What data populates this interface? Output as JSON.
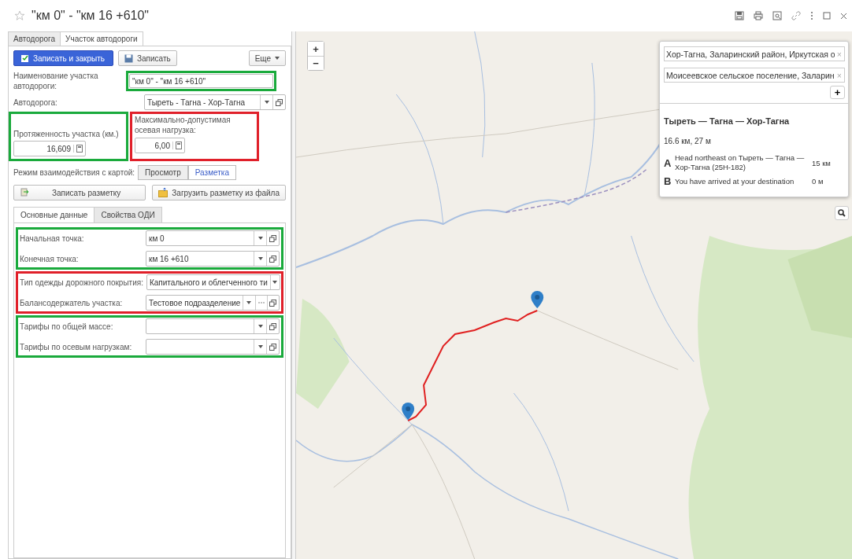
{
  "window": {
    "title": "\"км 0\" - \"км 16 +610\"",
    "favorite": false
  },
  "tabs": [
    {
      "label": "Автодорога",
      "selected": false
    },
    {
      "label": "Участок автодороги",
      "selected": true
    }
  ],
  "toolbar": {
    "save_close": "Записать и закрыть",
    "save": "Записать",
    "more": "Еще"
  },
  "name_field": {
    "label": "Наименование участка автодороги:",
    "value": "\"км 0\" - \"км 16 +610\"",
    "color": "#1aaa3c"
  },
  "road_field": {
    "label": "Автодорога:",
    "value": "Тыреть - Тагна - Хор-Тагна"
  },
  "length_field": {
    "label": "Протяженность участка (км.)",
    "value": "16,609",
    "color": "#1aaa3c"
  },
  "load_field": {
    "label": "Максимально-допустимая осевая нагрузка:",
    "value": "6,00",
    "color": "#e0202a"
  },
  "map_mode": {
    "label": "Режим взаимодействия с картой:",
    "options": [
      {
        "label": "Просмотр",
        "selected": false
      },
      {
        "label": "Разметка",
        "selected": true
      }
    ]
  },
  "markup_buttons": [
    "Записать разметку",
    "Загрузить разметку из файла"
  ],
  "inner_tabs": [
    {
      "label": "Основные данные",
      "selected": true
    },
    {
      "label": "Свойства ОДИ",
      "selected": false
    }
  ],
  "groups": [
    {
      "color": "#1aaa3c",
      "fields": [
        {
          "kind": "combo",
          "label": "Начальная точка:",
          "value": "км 0"
        },
        {
          "kind": "combo",
          "label": "Конечная точка:",
          "value": "км 16 +610"
        }
      ]
    },
    {
      "color": "#e0202a",
      "fields": [
        {
          "kind": "dropdown",
          "label": "Тип одежды дорожного покрытия:",
          "value": "Капитального и облегченного ти"
        },
        {
          "kind": "combo-choose",
          "label": "Балансодержатель участка:",
          "value": "Тестовое подразделение"
        }
      ]
    },
    {
      "color": "#1aaa3c",
      "fields": [
        {
          "kind": "combo",
          "label": "Тарифы по общей массе:"
        },
        {
          "kind": "combo",
          "label": "Тарифы по осевым нагрузкам:"
        }
      ]
    }
  ],
  "map": {
    "zoom_in": "+",
    "zoom_out": "−",
    "route_panel": {
      "waypoints": [
        "Хор-Тагна, Заларинский район, Иркутская о",
        "Моисеевское сельское поселение, Заларин"
      ],
      "remove": "×",
      "add": "+",
      "route_name": "Тыреть — Тагна — Хор-Тагна",
      "summary": "16.6 км, 27 м",
      "steps": [
        {
          "marker": "A",
          "text": "Head northeast on Тыреть — Тагна — Хор-Тагна (25Н-182)",
          "distance": "15 км"
        },
        {
          "marker": "B",
          "text": "You have arrived at your destination",
          "distance": "0 м"
        }
      ]
    }
  }
}
